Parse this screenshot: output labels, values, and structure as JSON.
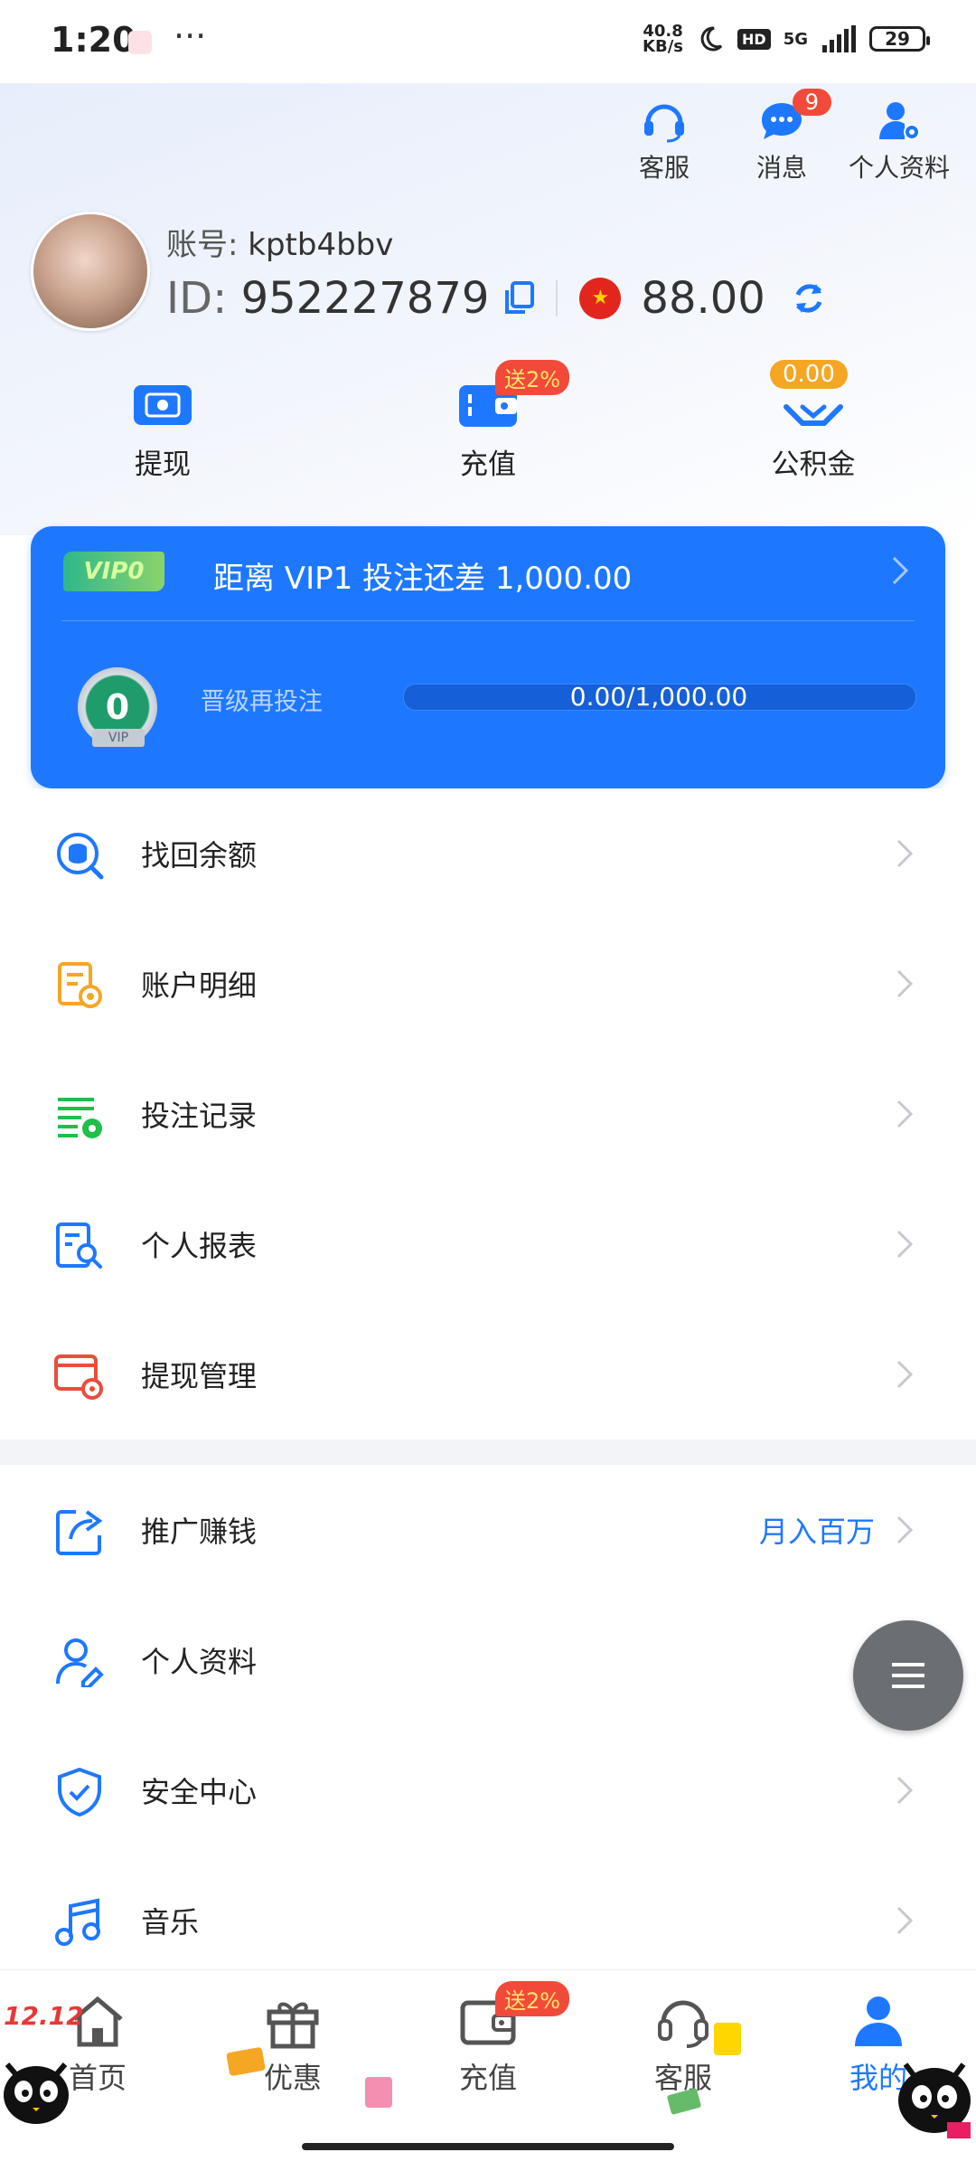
{
  "status_bar": {
    "time": "1:20",
    "more": "···",
    "net_speed_value": "40.8",
    "net_speed_unit": "KB/s",
    "hd": "HD",
    "signal": "5G",
    "battery": "29"
  },
  "header_actions": [
    {
      "label": "客服",
      "icon": "headset-icon"
    },
    {
      "label": "消息",
      "icon": "chat-icon",
      "badge": "9"
    },
    {
      "label": "个人资料",
      "icon": "user-settings-icon"
    }
  ],
  "profile": {
    "account_label": "账号:",
    "account_value": "kptb4bbv",
    "id_label": "ID:",
    "id_value": "952227879",
    "balance": "88.00"
  },
  "quick_actions": [
    {
      "label": "提现",
      "icon": "withdraw-icon"
    },
    {
      "label": "充值",
      "icon": "wallet-icon",
      "badge": "送2%"
    },
    {
      "label": "公积金",
      "icon": "fund-icon",
      "badge": "0.00"
    }
  ],
  "vip": {
    "tag": "VIP0",
    "title": "距离 VIP1 投注还差 1,000.00",
    "medal_level": "0",
    "medal_tag": "VIP",
    "sub_label": "晋级再投注",
    "progress_text": "0.00/1,000.00",
    "progress_fraction": 0
  },
  "menu_group_1": [
    {
      "label": "找回余额",
      "icon": "recover-balance-icon"
    },
    {
      "label": "账户明细",
      "icon": "account-detail-icon"
    },
    {
      "label": "投注记录",
      "icon": "bet-record-icon"
    },
    {
      "label": "个人报表",
      "icon": "report-icon"
    },
    {
      "label": "提现管理",
      "icon": "withdraw-manage-icon"
    }
  ],
  "menu_group_2": [
    {
      "label": "推广赚钱",
      "icon": "share-icon",
      "extra": "月入百万"
    },
    {
      "label": "个人资料",
      "icon": "profile-edit-icon"
    },
    {
      "label": "安全中心",
      "icon": "shield-icon"
    },
    {
      "label": "音乐",
      "icon": "music-icon"
    }
  ],
  "bottom_nav": [
    {
      "label": "首页",
      "icon": "home-icon"
    },
    {
      "label": "优惠",
      "icon": "gift-icon"
    },
    {
      "label": "充值",
      "icon": "wallet-icon",
      "badge": "送2%"
    },
    {
      "label": "客服",
      "icon": "headset-icon"
    },
    {
      "label": "我的",
      "icon": "user-icon",
      "active": true
    }
  ],
  "decor": {
    "promo_text": "12.12"
  },
  "colors": {
    "accent": "#1e78ff",
    "badge": "#f24a3a",
    "gold": "#f5a623",
    "green": "#1fbf4a",
    "red_icon": "#e84d3d"
  }
}
